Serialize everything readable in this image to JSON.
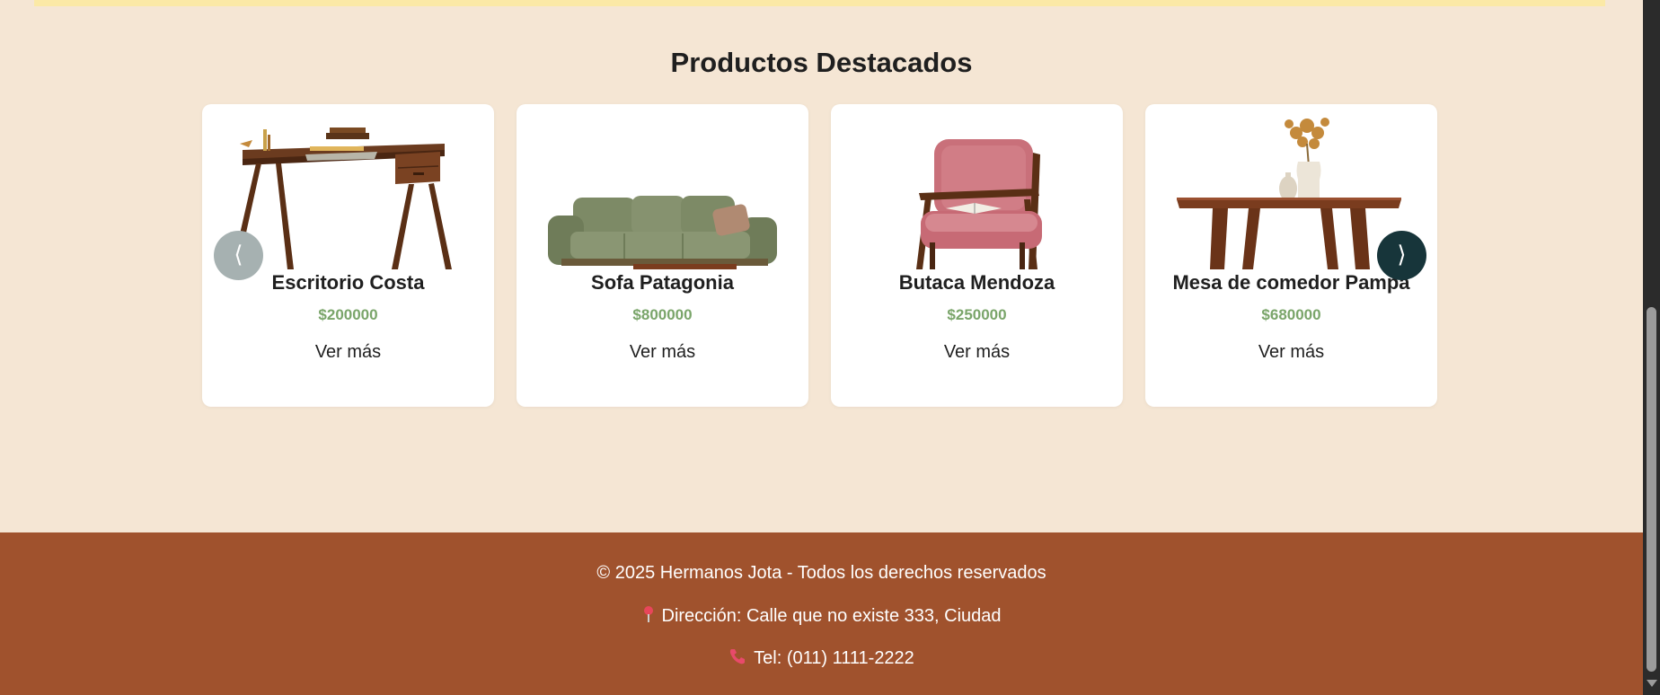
{
  "section": {
    "title": "Productos Destacados"
  },
  "carousel": {
    "prev_icon": "chevron-left-icon",
    "next_icon": "chevron-right-icon",
    "prev_symbol": "⟨",
    "next_symbol": "⟩",
    "products": [
      {
        "name": "Escritorio Costa",
        "price": "$200000",
        "link": "Ver más",
        "image": "desk"
      },
      {
        "name": "Sofa Patagonia",
        "price": "$800000",
        "link": "Ver más",
        "image": "sofa"
      },
      {
        "name": "Butaca Mendoza",
        "price": "$250000",
        "link": "Ver más",
        "image": "armchair"
      },
      {
        "name": "Mesa de comedor Pampa",
        "price": "$680000",
        "link": "Ver más",
        "image": "dining-table"
      }
    ]
  },
  "footer": {
    "copyright": "© 2025 Hermanos Jota - Todos los derechos reservados",
    "address": "Dirección: Calle que no existe 333, Ciudad",
    "phone": "Tel: (011) 1111-2222",
    "address_icon": "pin-icon",
    "phone_icon": "phone-icon"
  },
  "colors": {
    "background": "#f5e6d4",
    "footer": "#a0522d",
    "price": "#7aa56a",
    "nav_next": "#17353a",
    "nav_prev": "#a6b1b1",
    "top_strip": "#fbe9a6"
  }
}
